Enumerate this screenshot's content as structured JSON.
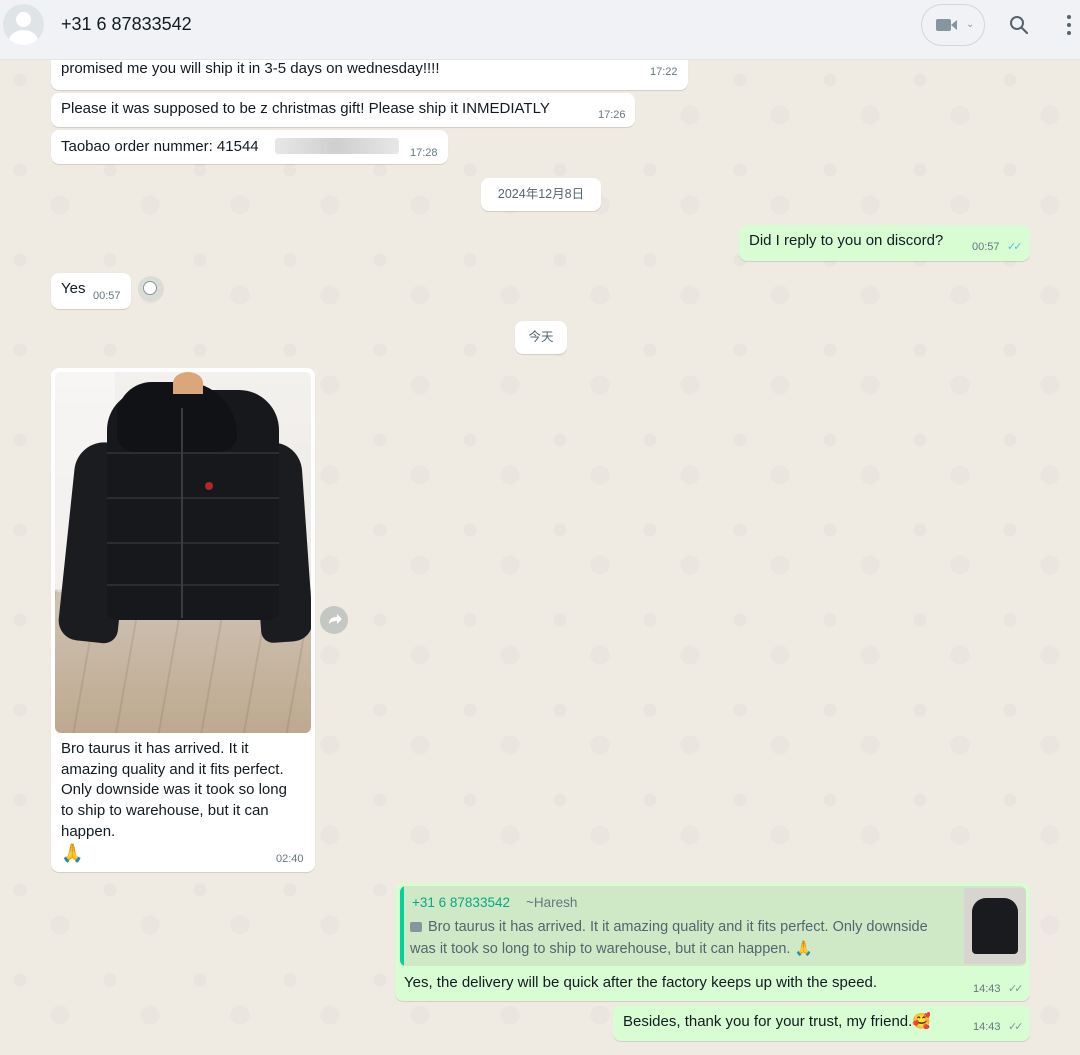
{
  "header": {
    "contact": "+31 6 87833542",
    "icons": [
      "avatar",
      "video-call-icon",
      "chevron-down-icon",
      "search-icon",
      "menu-icon"
    ]
  },
  "messages": [
    {
      "text": "promised me you will ship it in 3-5 days on wednesday!!!!",
      "time": "17:22"
    },
    {
      "text": "Please it was supposed to be z  christmas gift! Please ship it INMEDIATLY",
      "time": "17:26"
    },
    {
      "text": "Taobao order nummer: 41544",
      "time": "17:28"
    },
    {
      "text": "Did I reply to you on discord?",
      "time": "00:57"
    },
    {
      "text": "Yes",
      "time": "00:57"
    },
    {
      "text": "Bro taurus it has arrived. It it amazing quality and it fits perfect. Only downside was it took so long to ship to warehouse, but it can happen.",
      "emoji": "🙏",
      "time": "02:40"
    },
    {
      "text": "Yes, the delivery will be quick after the factory keeps up with the speed.",
      "time": "14:43"
    },
    {
      "text": "Besides, thank you for your trust, my friend.",
      "emoji": "🥰",
      "time": "14:43"
    }
  ],
  "date_chips": [
    "2024年12月8日",
    "今天"
  ],
  "quote": {
    "name": "+31 6 87833542",
    "alias": "~Haresh",
    "text": "Bro taurus it has arrived. It it amazing quality and it fits perfect. Only downside was it took so long to ship to warehouse, but it can happen.",
    "emoji": "🙏"
  },
  "colors": {
    "chat_bg": "#efeae2",
    "incoming": "#ffffff",
    "outgoing": "#d9fdd3",
    "read_ticks": "#53bdeb",
    "quote_accent": "#06cf9c"
  }
}
